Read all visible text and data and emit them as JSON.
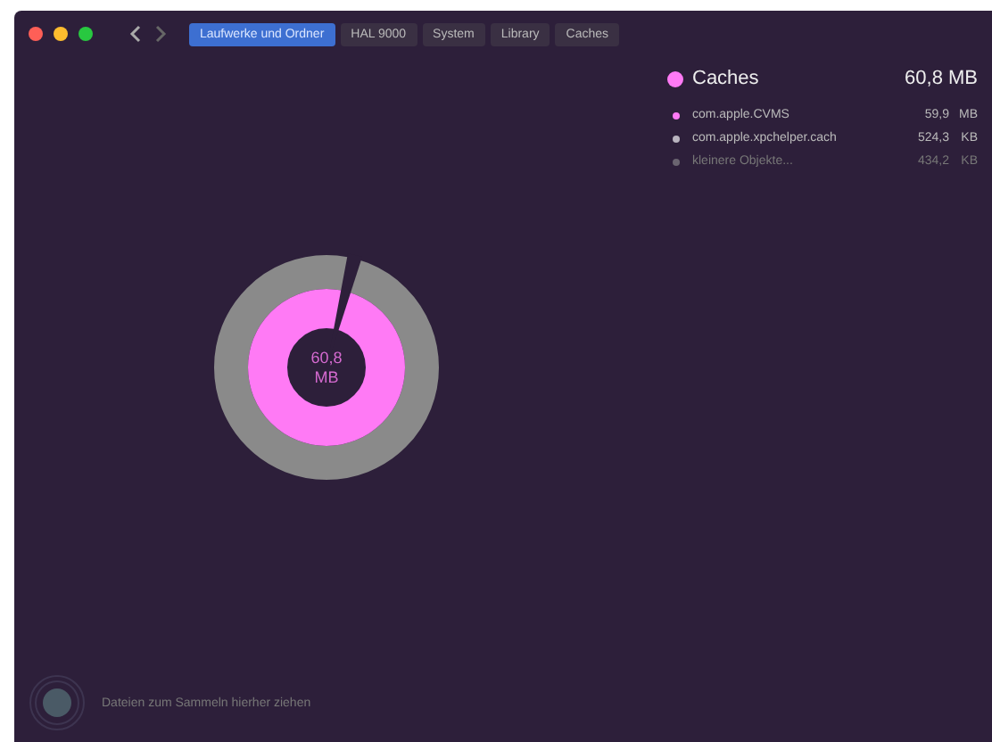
{
  "window": {
    "controls": [
      {
        "color": "#fe5f57"
      },
      {
        "color": "#febc2e"
      },
      {
        "color": "#28c840"
      }
    ]
  },
  "breadcrumbs": [
    {
      "label": "Laufwerke und Ordner",
      "selected": true
    },
    {
      "label": "HAL 9000",
      "selected": false
    },
    {
      "label": "System",
      "selected": false
    },
    {
      "label": "Library",
      "selected": false
    },
    {
      "label": "Caches",
      "selected": false
    }
  ],
  "summary": {
    "name": "Caches",
    "size": "60,8 MB",
    "color": "#ff7af5"
  },
  "items": [
    {
      "name": "com.apple.CVMS",
      "size": "59,9",
      "unit": "MB",
      "color": "#ff7af5"
    },
    {
      "name": "com.apple.xpchelper.cach",
      "size": "524,3",
      "unit": "KB",
      "color": "#b9b4bf"
    },
    {
      "name": "kleinere Objekte...",
      "size": "434,2",
      "unit": "KB",
      "color": "#6a6470"
    }
  ],
  "donut": {
    "center_label": "60,8\nMB"
  },
  "footer": {
    "hint": "Dateien zum Sammeln hierher ziehen"
  }
}
